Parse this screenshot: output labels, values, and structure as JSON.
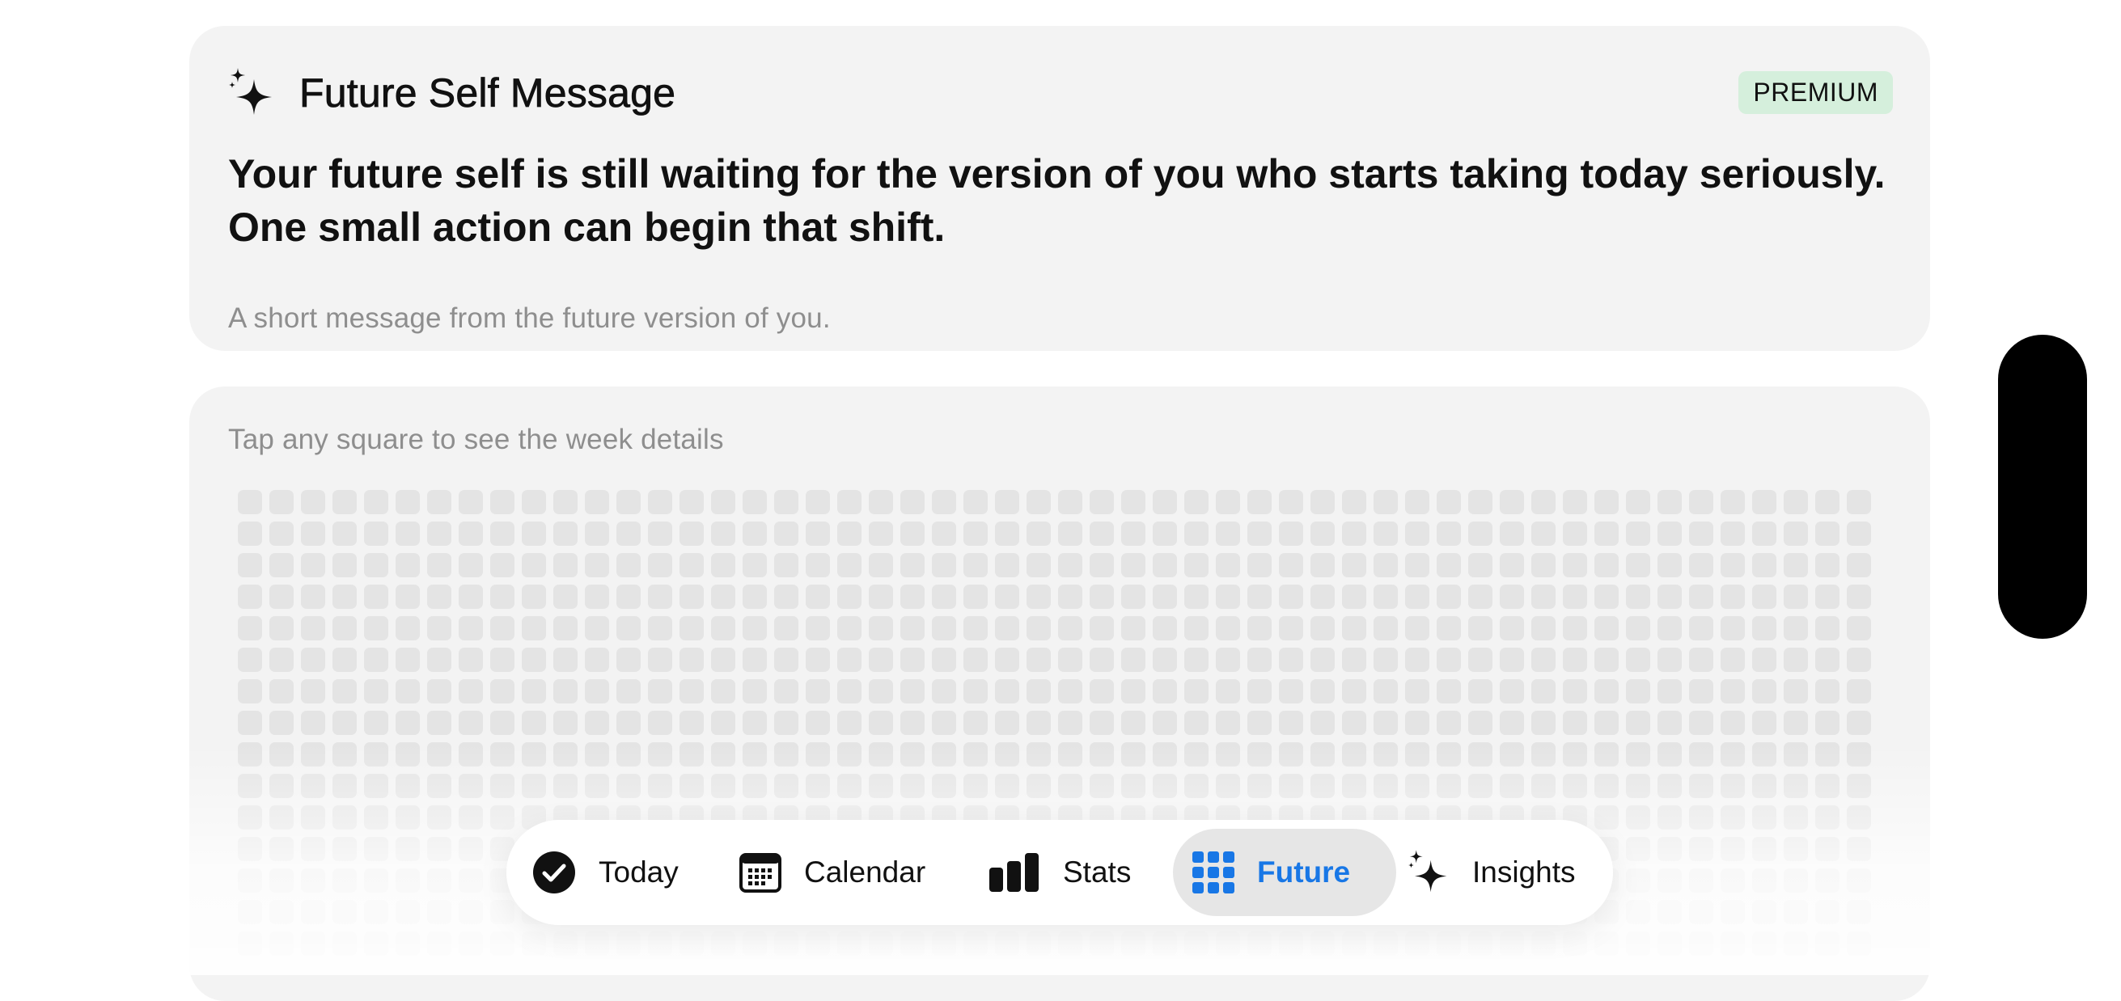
{
  "message_card": {
    "title": "Future Self Message",
    "icon": "sparkle-icon",
    "badge": "PREMIUM",
    "badge_color": "#d5efdc",
    "body": "Your future self is still waiting for the version of you who starts taking today seriously. One small action can begin that shift.",
    "footnote": "A short message from the future version of you."
  },
  "grid_card": {
    "hint": "Tap any square to see the week details",
    "cell_color": "#e4e4e4"
  },
  "tabbar": {
    "accent": "#1877e6",
    "tabs": [
      {
        "label": "Today",
        "icon": "checkmark-circle-icon",
        "active": false
      },
      {
        "label": "Calendar",
        "icon": "calendar-icon",
        "active": false
      },
      {
        "label": "Stats",
        "icon": "bar-chart-icon",
        "active": false
      },
      {
        "label": "Future",
        "icon": "grid-icon",
        "active": true
      },
      {
        "label": "Insights",
        "icon": "sparkle-icon",
        "active": false
      }
    ]
  }
}
